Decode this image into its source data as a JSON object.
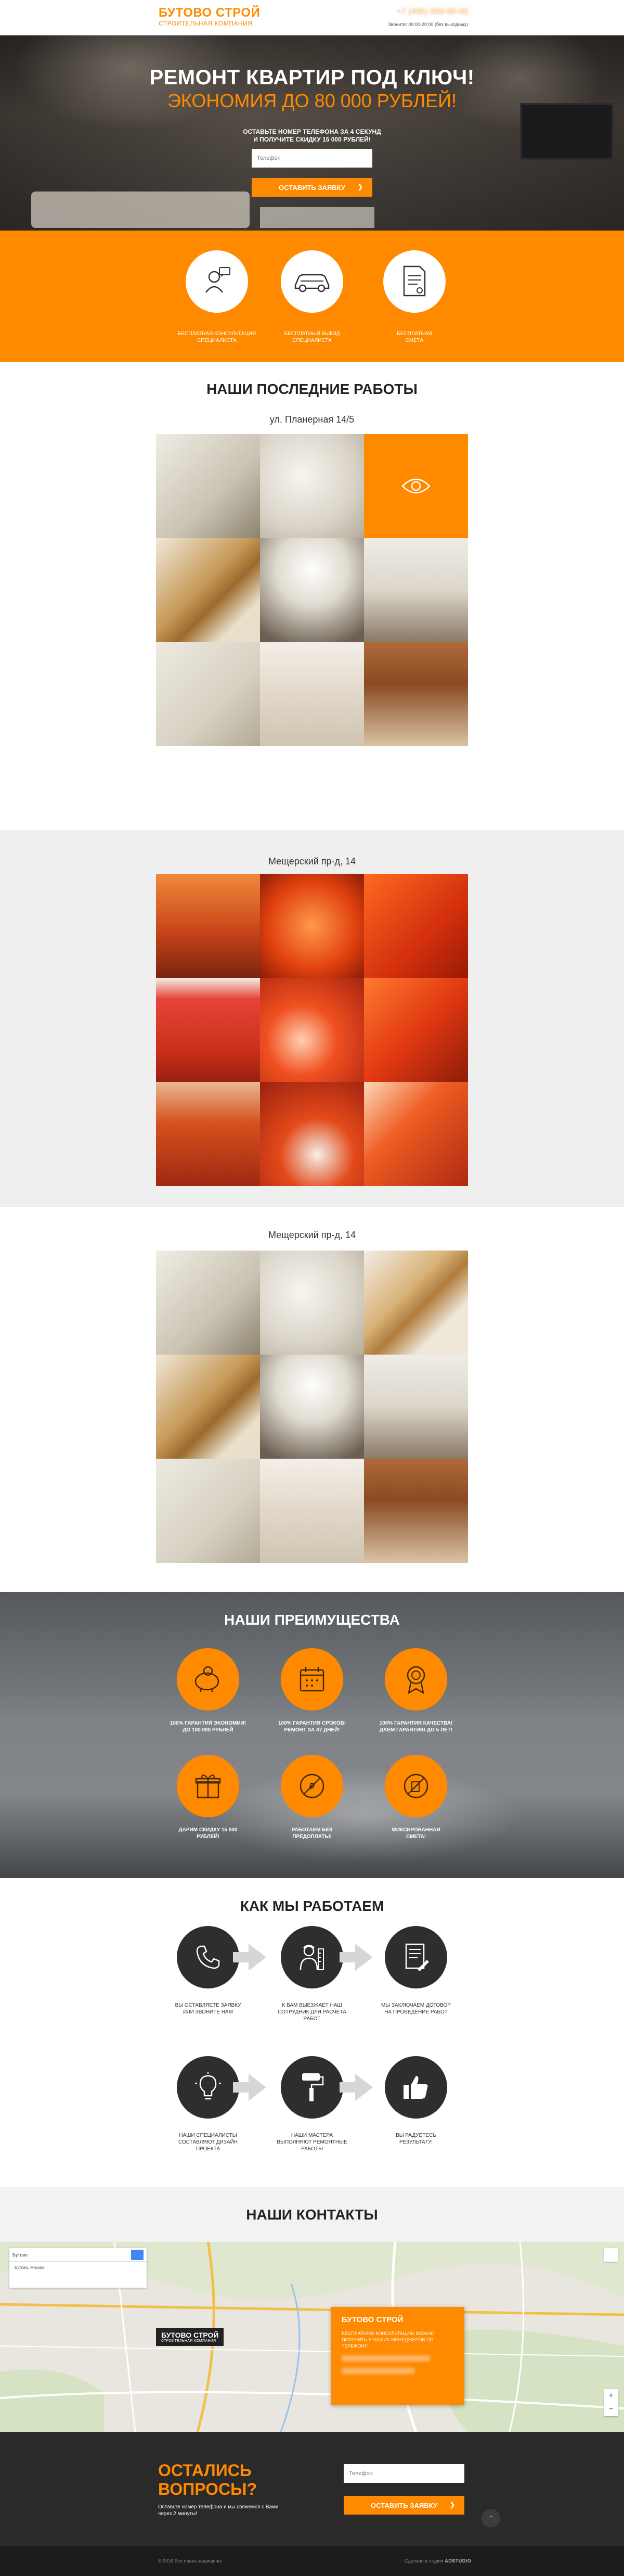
{
  "header": {
    "logo_title": "БУТОВО СТРОЙ",
    "logo_subtitle": "СТРОИТЕЛЬНАЯ КОМПАНИЯ",
    "phone": "+7 (495) 000-00-00",
    "hours": "Звоните: 09:00-20:00 (без выходных)"
  },
  "hero": {
    "title": "РЕМОНТ КВАРТИР ПОД КЛЮЧ!",
    "subtitle": "ЭКОНОМИЯ ДО 80 000 РУБЛЕЙ!",
    "note_line1": "ОСТАВЬТЕ НОМЕР ТЕЛЕФОНА ЗА 4 СЕКУНД",
    "note_line2": "И ПОЛУЧИТЕ СКИДКУ 15 000 РУБЛЕЙ!",
    "phone_placeholder": "Телефон",
    "button_label": "ОСТАВИТЬ ЗАЯВКУ",
    "button_arrow": "❯"
  },
  "features": [
    {
      "icon": "consultant-icon",
      "line1": "БЕСПЛАТНАЯ КОНСУЛЬТАЦИЯ",
      "line2": "СПЕЦИАЛИСТА"
    },
    {
      "icon": "car-icon",
      "line1": "БЕСПЛАТНЫЙ ВЫЕЗД",
      "line2": "СПЕЦИАЛИСТА"
    },
    {
      "icon": "document-icon",
      "line1": "БЕСПЛАТНАЯ",
      "line2": "СМЕТА"
    }
  ],
  "works": {
    "title": "НАШИ ПОСЛЕДНИЕ РАБОТЫ",
    "projects": [
      {
        "title": "ул. Планерная 14/5"
      },
      {
        "title": "Мещерский пр-д, 14"
      },
      {
        "title": "Мещерский пр-д, 14"
      }
    ]
  },
  "advantages": {
    "title": "НАШИ ПРЕИМУЩЕСТВА",
    "items": [
      {
        "icon": "piggy-bank-icon",
        "line1": "100% ГАРАНТИЯ ЭКОНОМИИ!",
        "line2": "ДО 100 000 РУБЛЕЙ"
      },
      {
        "icon": "calendar-icon",
        "line1": "100% ГАРАНТИЯ СРОКОВ!",
        "line2": "РЕМОНТ ЗА 47 ДНЕЙ!"
      },
      {
        "icon": "quality-medal-icon",
        "line1": "100% ГАРАНТИЯ КАЧЕСТВА!",
        "line2": "ДАЕМ ГАРАНТИЮ ДО 5 ЛЕТ!"
      },
      {
        "icon": "gift-icon",
        "line1": "ДАРИМ СКИДКУ 15 000",
        "line2": "РУБЛЕЙ!"
      },
      {
        "icon": "prepayment-icon",
        "line1": "РАБОТАЕМ БЕЗ",
        "line2": "ПРЕДОПЛАТЫ!"
      },
      {
        "icon": "fixed-price-icon",
        "line1": "ФИКСИРОВАННАЯ",
        "line2": "СМЕТА!"
      }
    ]
  },
  "how": {
    "title": "КАК МЫ РАБОТАЕМ",
    "steps": [
      {
        "icon": "phone-icon",
        "line1": "ВЫ ОСТАВЛЯЕТЕ ЗАЯВКУ",
        "line2": "ИЛИ ЗВОНИТЕ НАМ",
        "line3": ""
      },
      {
        "icon": "engineer-icon",
        "line1": "К ВАМ ВЫЕЗЖАЕТ НАШ",
        "line2": "СОТРУДНИК ДЛЯ РАСЧЕТА",
        "line3": "РАБОТ"
      },
      {
        "icon": "contract-icon",
        "line1": "МЫ ЗАКЛЮЧАЕМ ДОГОВОР",
        "line2": "НА ПРОВЕДЕНИЕ РАБОТ",
        "line3": ""
      },
      {
        "icon": "lightbulb-icon",
        "line1": "НАШИ СПЕЦИАЛИСТЫ",
        "line2": "СОСТАВЛЯЮТ ДИЗАЙН",
        "line3": "ПРОЕКТА"
      },
      {
        "icon": "paint-roller-icon",
        "line1": "НАШИ МАСТЕРА",
        "line2": "ВЫПОЛНЯЮТ РЕМОНТНЫЕ",
        "line3": "РАБОТЫ"
      },
      {
        "icon": "thumbs-up-icon",
        "line1": "ВЫ РАДУЕТЕСЬ",
        "line2": "РЕЗУЛЬТАТУ!",
        "line3": ""
      }
    ]
  },
  "contacts": {
    "title": "НАШИ КОНТАКТЫ",
    "map_search_result": "Бутово",
    "map_search_line2": "Бутово, Москва",
    "map_zoom_in": "+",
    "map_zoom_out": "−",
    "marker_title": "БУТОВО СТРОЙ",
    "marker_subtitle": "СТРОИТЕЛЬНАЯ КОМПАНИЯ",
    "card_title": "БУТОВО СТРОЙ",
    "card_desc": "БЕСПЛАТНУЮ КОНСУЛЬТАЦИЮ МОЖНО ПОЛУЧИТЬ У НАШИХ МЕНЕДЖЕРОВ ПО ТЕЛЕФОНУ:"
  },
  "cta": {
    "title_line1": "ОСТАЛИСЬ",
    "title_line2": "ВОПРОСЫ?",
    "note": "Оставьте номер телефона и мы свяжемся с Вами через 2 минуты!",
    "phone_placeholder": "Телефон",
    "button_label": "ОСТАВИТЬ ЗАЯВКУ",
    "button_arrow": "❯",
    "to_top": "⌃",
    "copyright": "© 2016 Все права защищены",
    "made_by_label": "Сделано в студии",
    "made_by_name": "ADSTUDIO"
  },
  "colors": {
    "accent": "#ff8a00",
    "dark": "#2a2a2a"
  }
}
